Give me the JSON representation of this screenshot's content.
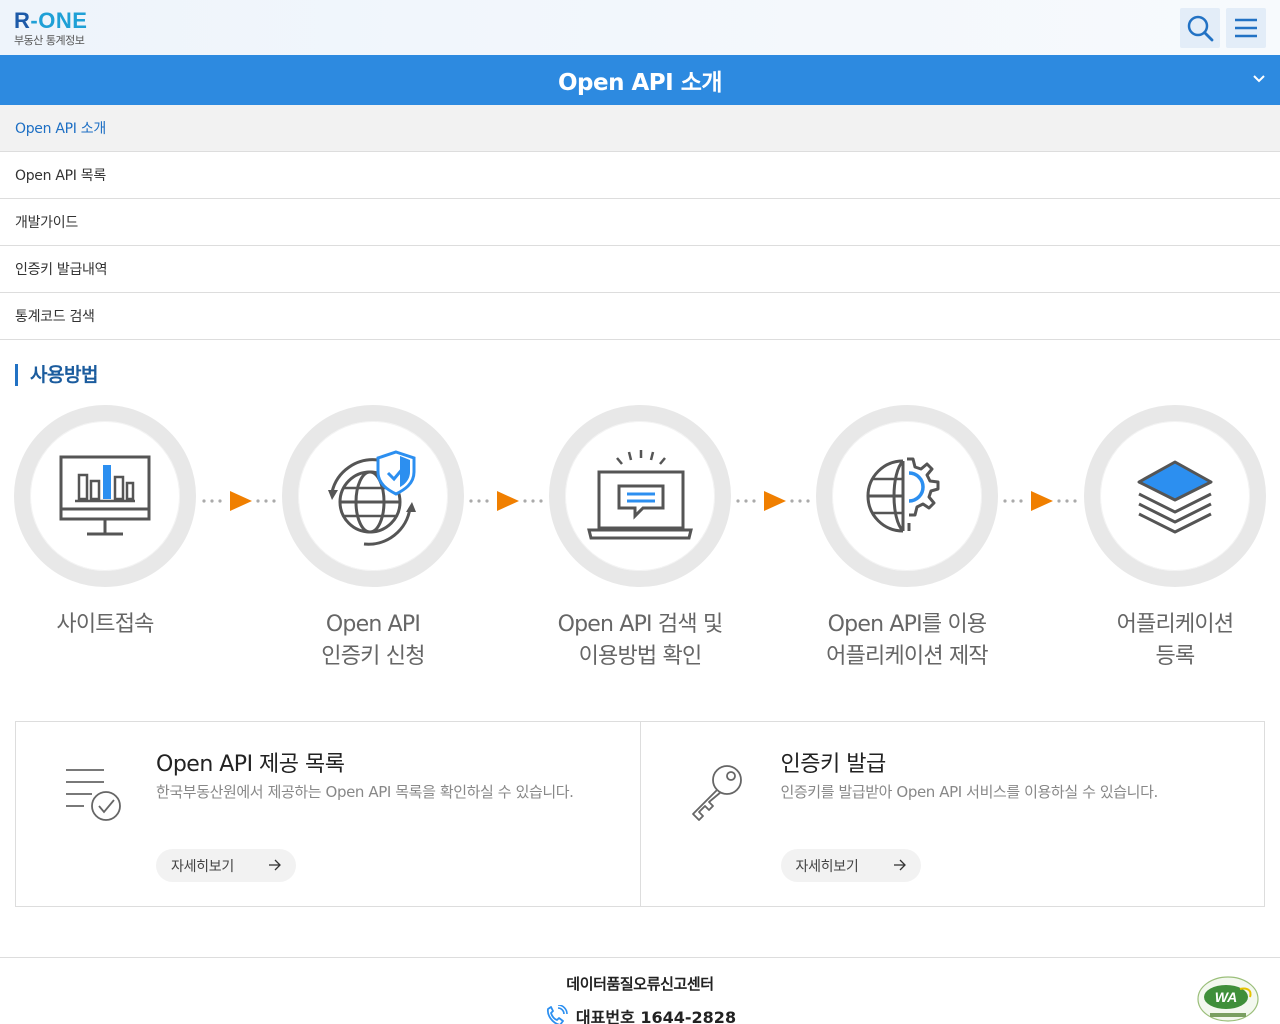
{
  "header": {
    "logo_text": "R-ONE",
    "logo_sub": "부동산 통계정보",
    "search_icon": "search-icon",
    "menu_icon": "hamburger-icon"
  },
  "title_bar": {
    "title": "Open API 소개",
    "toggle_icon": "chevron-down-icon"
  },
  "menu": {
    "items": [
      {
        "label": "Open API 소개",
        "active": true
      },
      {
        "label": "Open API 목록",
        "active": false
      },
      {
        "label": "개발가이드",
        "active": false
      },
      {
        "label": "인증키 발급내역",
        "active": false
      },
      {
        "label": "통계코드 검색",
        "active": false
      }
    ]
  },
  "usage": {
    "title": "사용방법",
    "steps": [
      {
        "label": "사이트접속",
        "icon": "monitor-chart-icon"
      },
      {
        "label": "Open API\n인증키 신청",
        "icon": "globe-shield-icon"
      },
      {
        "label": "Open API 검색 및\n이용방법 확인",
        "icon": "laptop-message-icon"
      },
      {
        "label": "Open API를 이용\n어플리케이션 제작",
        "icon": "globe-gear-icon"
      },
      {
        "label": "어플리케이션\n등록",
        "icon": "layers-icon"
      }
    ]
  },
  "cards": [
    {
      "title": "Open API 제공 목록",
      "desc": "한국부동산원에서 제공하는 Open API 목록을 확인하실 수 있습니다.",
      "button": "자세히보기",
      "icon": "checklist-icon"
    },
    {
      "title": "인증키 발급",
      "desc": "인증키를 발급받아 Open API 서비스를 이용하실 수 있습니다.",
      "button": "자세히보기",
      "icon": "key-icon"
    }
  ],
  "footer": {
    "title": "데이터품질오류신고센터",
    "phone_label": "대표번호 1644-2828",
    "badge_text": "WA"
  },
  "colors": {
    "primary_blue": "#2d8ae0",
    "arrow_orange": "#f07f00",
    "icon_blue": "#2c8ff0"
  }
}
